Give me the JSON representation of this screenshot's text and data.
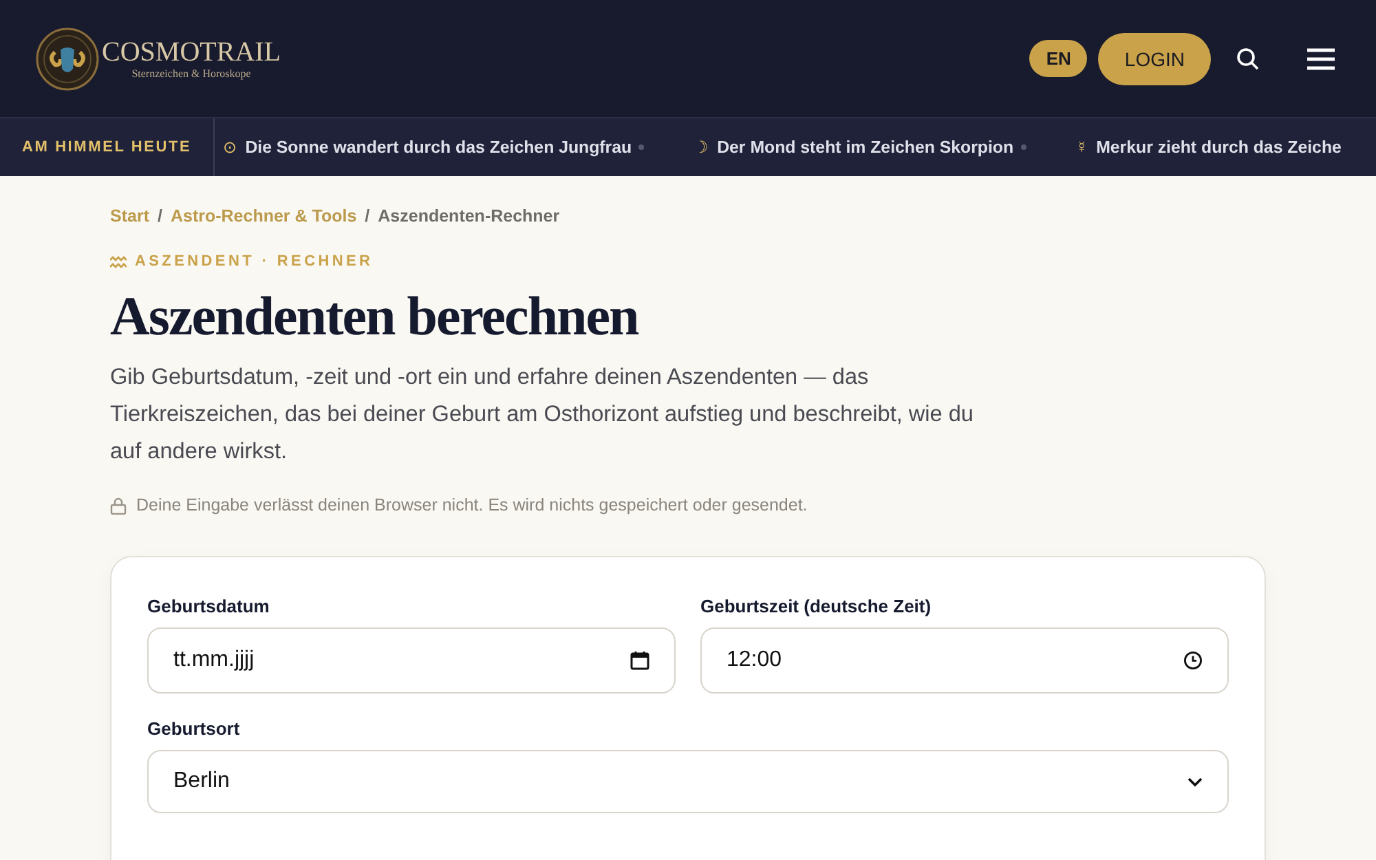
{
  "header": {
    "logo_title": "COSMOTRAIL",
    "logo_subtitle": "Sternzeichen & Horoskope",
    "language_button": "EN",
    "login_button": "LOGIN"
  },
  "ticker": {
    "label": "AM HIMMEL HEUTE",
    "items": [
      {
        "symbol": "⊙",
        "text": "Die Sonne wandert durch das Zeichen Jungfrau"
      },
      {
        "symbol": "☽",
        "text": "Der Mond steht im Zeichen Skorpion"
      },
      {
        "symbol": "☿",
        "text": "Merkur zieht durch das Zeiche"
      }
    ]
  },
  "breadcrumb": [
    {
      "label": "Start",
      "current": false
    },
    {
      "separator": "/",
      "label": "Astro-Rechner & Tools",
      "current": false
    },
    {
      "separator": "/",
      "label": "Aszendenten-Rechner",
      "current": true
    }
  ],
  "eyebrow": "ASZENDENT · RECHNER",
  "title": "Aszendenten berechnen",
  "intro": "Gib Geburtsdatum, -zeit und -ort ein und erfahre deinen Aszendenten — das Tierkreiszeichen, das bei deiner Geburt am Osthorizont aufstieg und beschreibt, wie du auf andere wirkst.",
  "privacy_note": "Deine Eingabe verlässt deinen Browser nicht. Es wird nichts gespeichert oder gesendet.",
  "form": {
    "fields": [
      {
        "kind": "date",
        "label": "Geburtsdatum",
        "placeholder": "tt.mm.jjjj"
      },
      {
        "kind": "time",
        "label": "Geburtszeit (deutsche Zeit)",
        "value": "12:00"
      },
      {
        "kind": "select",
        "label": "Geburtsort",
        "value": "Berlin"
      }
    ]
  }
}
